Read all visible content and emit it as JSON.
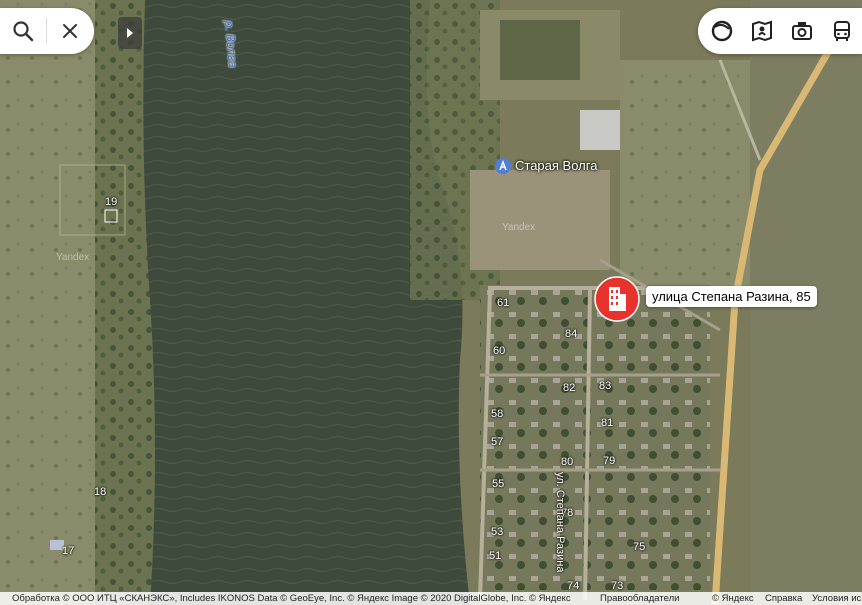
{
  "map": {
    "river_label": "р. Волга",
    "place_label": "Старая Волга",
    "watermark": "Yandex",
    "house_numbers": [
      "19",
      "18",
      "17",
      "61",
      "84",
      "60",
      "82",
      "83",
      "58",
      "81",
      "57",
      "80",
      "79",
      "55",
      "78",
      "53",
      "75",
      "51",
      "74",
      "73"
    ],
    "street_label": "ул. Степана Разина",
    "address_popup": "улица Степана Разина, 85"
  },
  "colors": {
    "pin": "#e8322c",
    "road": "#d9b874",
    "water": "#3e4a3c"
  },
  "toolbar_left": {
    "search_icon": "search-icon",
    "close_icon": "close-icon"
  },
  "toolbar_right": {
    "icons": [
      "layers-icon",
      "map-panorama-icon",
      "camera-icon",
      "bus-icon"
    ]
  },
  "footer": {
    "attribution": "Обработка © ООО ИТЦ «СКАНЭКС», Includes IKONOS Data © GeoEye, Inc. © Яндекс Image © 2020 DigitalGlobe, Inc. © Яндекс",
    "rights": "Правообладатели",
    "yandex": "© Яндекс",
    "help": "Справка",
    "terms": "Условия ис"
  }
}
